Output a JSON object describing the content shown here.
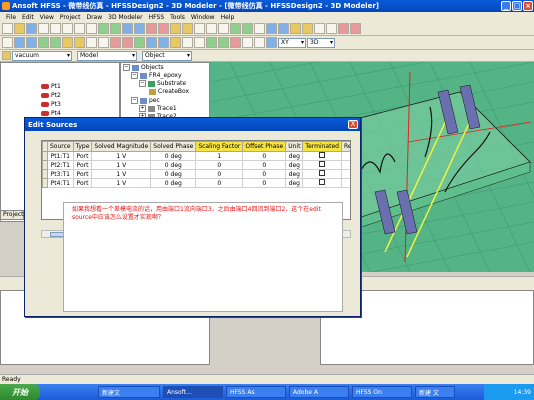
{
  "window": {
    "title": "Ansoft HFSS - 微带线仿真 - HFSSDesign2 - 3D Modeler - [微带线仿真 - HFSSDesign2 - 3D Modeler]"
  },
  "menu": [
    "File",
    "Edit",
    "View",
    "Project",
    "Draw",
    "3D Modeler",
    "HFSS",
    "Tools",
    "Window",
    "Help"
  ],
  "toolbar": {
    "material_value": "vacuum",
    "model_value": "Model",
    "object_value": "Object",
    "plane_value": "XY",
    "dim_value": "3D"
  },
  "project_tab": "Project",
  "ports": [
    "Pt1",
    "Pt2",
    "Pt3",
    "Pt4"
  ],
  "tree": [
    {
      "label": "Objects",
      "level": 0,
      "exp": "−"
    },
    {
      "label": "FR4_epoxy",
      "level": 1,
      "exp": "−"
    },
    {
      "label": "Substrate",
      "level": 2,
      "exp": "−"
    },
    {
      "label": "CreateBox",
      "level": 3,
      "exp": ""
    },
    {
      "label": "pec",
      "level": 1,
      "exp": "−"
    },
    {
      "label": "Trace1",
      "level": 2,
      "exp": "+"
    },
    {
      "label": "Trace2",
      "level": 2,
      "exp": "+"
    }
  ],
  "dialog": {
    "title": "Edit Sources",
    "close": "X",
    "columns": [
      "Source",
      "Type",
      "Solved Magnitude",
      "Solved Phase",
      "Scaling Factor",
      "Offset Phase",
      "Unit",
      "Terminated",
      "Res"
    ],
    "rows": [
      [
        "Pt1:T1",
        "Port",
        "1 V",
        "0 deg",
        "1",
        "0",
        "deg"
      ],
      [
        "Pt2:T1",
        "Port",
        "1 V",
        "0 deg",
        "0",
        "0",
        "deg"
      ],
      [
        "Pt3:T1",
        "Port",
        "1 V",
        "0 deg",
        "0",
        "0",
        "deg"
      ],
      [
        "Pt4:T1",
        "Port",
        "1 V",
        "0 deg",
        "0",
        "0",
        "deg"
      ]
    ],
    "note": "如果我想看一个差模电流的话，用由端口1流向端口3，之后由端口4回流到端口2，这个在edit source中应该怎么设置才实现啊？"
  },
  "status": {
    "text": "Ready"
  },
  "taskbar": {
    "start": "开始",
    "tasks": [
      "新建文",
      "Ansoft...",
      "HFSS As",
      "Adobe A",
      "HFSS On",
      "新建 文"
    ],
    "clock": "14:39"
  },
  "colors": {
    "accent": "#0a5bd9",
    "view_bg": "#54b486",
    "highlight_col": "#f5e342",
    "note_text": "#e81010"
  }
}
